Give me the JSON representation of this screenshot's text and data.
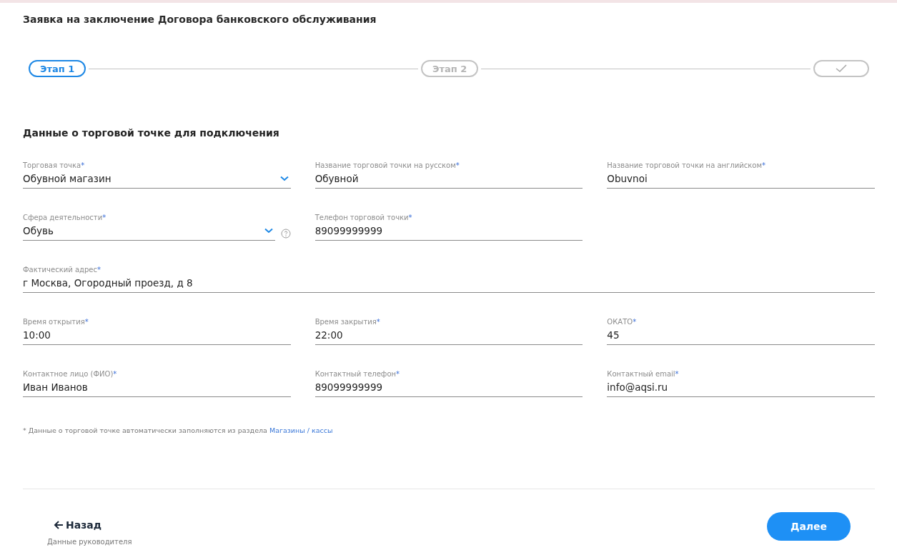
{
  "title": "Заявка на заключение Договора банковского обслуживания",
  "steps": [
    {
      "kind": "label",
      "label": "Этап 1",
      "selected": true
    },
    {
      "kind": "label",
      "label": "Этап 2",
      "selected": false
    },
    {
      "kind": "check",
      "selected": false
    }
  ],
  "section_title": "Данные о торговой точке для подключения",
  "rows": [
    {
      "fields": [
        {
          "kind": "select",
          "label": "Торговая точка",
          "required_mark": "*",
          "value": "Обувной магазин"
        },
        {
          "kind": "text",
          "label": "Название торговой точки на русском",
          "required_mark": "*",
          "value": "Обувной"
        },
        {
          "kind": "text",
          "label": "Название торговой точки на английском",
          "required_mark": "*",
          "value": "Obuvnoi"
        }
      ]
    },
    {
      "fields": [
        {
          "kind": "select",
          "label": "Сфера деятельности",
          "required_mark": "*",
          "value": "Обувь",
          "help": true
        },
        {
          "kind": "text",
          "label": "Телефон торговой точки",
          "required_mark": "*",
          "value": "89099999999"
        }
      ]
    },
    {
      "fields": [
        {
          "kind": "wide",
          "label": "Фактический адрес",
          "required_mark": "*",
          "value": "г Москва, Огородный проезд, д 8"
        }
      ]
    },
    {
      "fields": [
        {
          "kind": "text",
          "label": "Время открытия",
          "required_mark": "*",
          "value": "10:00"
        },
        {
          "kind": "text",
          "label": "Время закрытия",
          "required_mark": "*",
          "value": "22:00"
        },
        {
          "kind": "text",
          "label": "ОКАТО",
          "required_mark": "*",
          "value": "45"
        }
      ]
    },
    {
      "fields": [
        {
          "kind": "text",
          "label": "Контактное лицо (ФИО)",
          "required_mark": "*",
          "value": "Иван Иванов"
        },
        {
          "kind": "text",
          "label": "Контактный телефон",
          "required_mark": "*",
          "value": "89099999999"
        },
        {
          "kind": "text",
          "label": "Контактный email",
          "required_mark": "*",
          "value": "info@aqsi.ru"
        }
      ]
    }
  ],
  "note": {
    "text": "* Данные о торговой точке автоматически заполняются из раздела",
    "link": "Магазины / кассы"
  },
  "back": {
    "label": "Назад",
    "subtitle": "Данные руководителя"
  },
  "next": {
    "label": "Далее"
  }
}
